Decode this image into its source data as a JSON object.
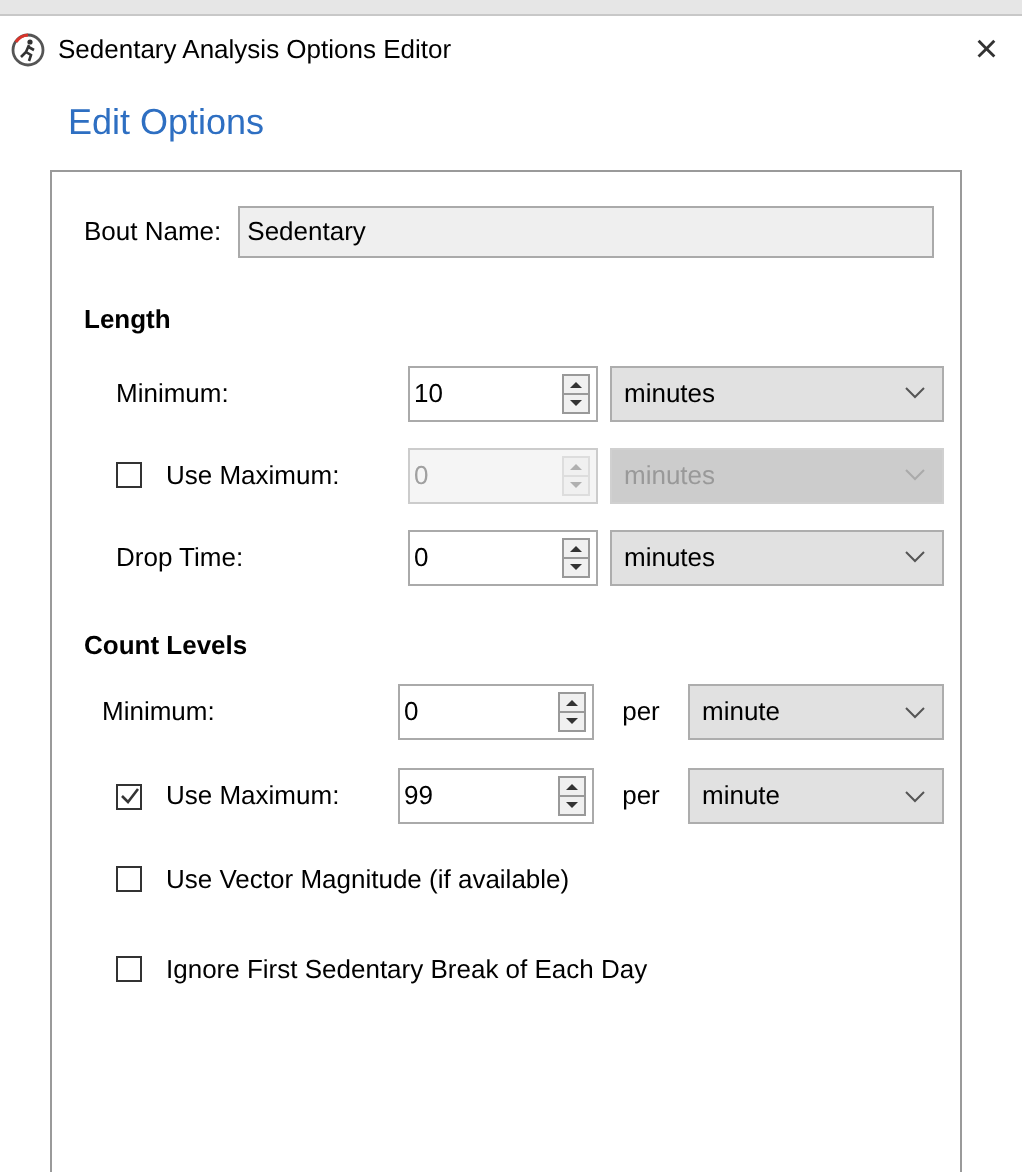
{
  "window": {
    "title": "Sedentary Analysis Options Editor",
    "close": "×"
  },
  "heading": "Edit Options",
  "bout_name": {
    "label": "Bout Name:",
    "value": "Sedentary"
  },
  "length": {
    "heading": "Length",
    "rows": [
      {
        "kind": "plain",
        "label": "Minimum:",
        "value": "10",
        "unit": "minutes",
        "disabled": false
      },
      {
        "kind": "checkbox",
        "checked": false,
        "label": "Use Maximum:",
        "value": "0",
        "unit": "minutes",
        "disabled": true
      },
      {
        "kind": "plain",
        "label": "Drop Time:",
        "value": "0",
        "unit": "minutes",
        "disabled": false
      }
    ]
  },
  "count_levels": {
    "heading": "Count Levels",
    "rows": [
      {
        "kind": "plain",
        "label": "Minimum:",
        "value": "0",
        "per": "per",
        "unit": "minute",
        "disabled": false
      },
      {
        "kind": "checkbox",
        "checked": true,
        "label": "Use Maximum:",
        "value": "99",
        "per": "per",
        "unit": "minute",
        "disabled": false
      }
    ],
    "options": [
      {
        "label": "Use Vector Magnitude (if available)",
        "checked": false
      },
      {
        "label": "Ignore First Sedentary Break of Each Day",
        "checked": false
      }
    ]
  }
}
